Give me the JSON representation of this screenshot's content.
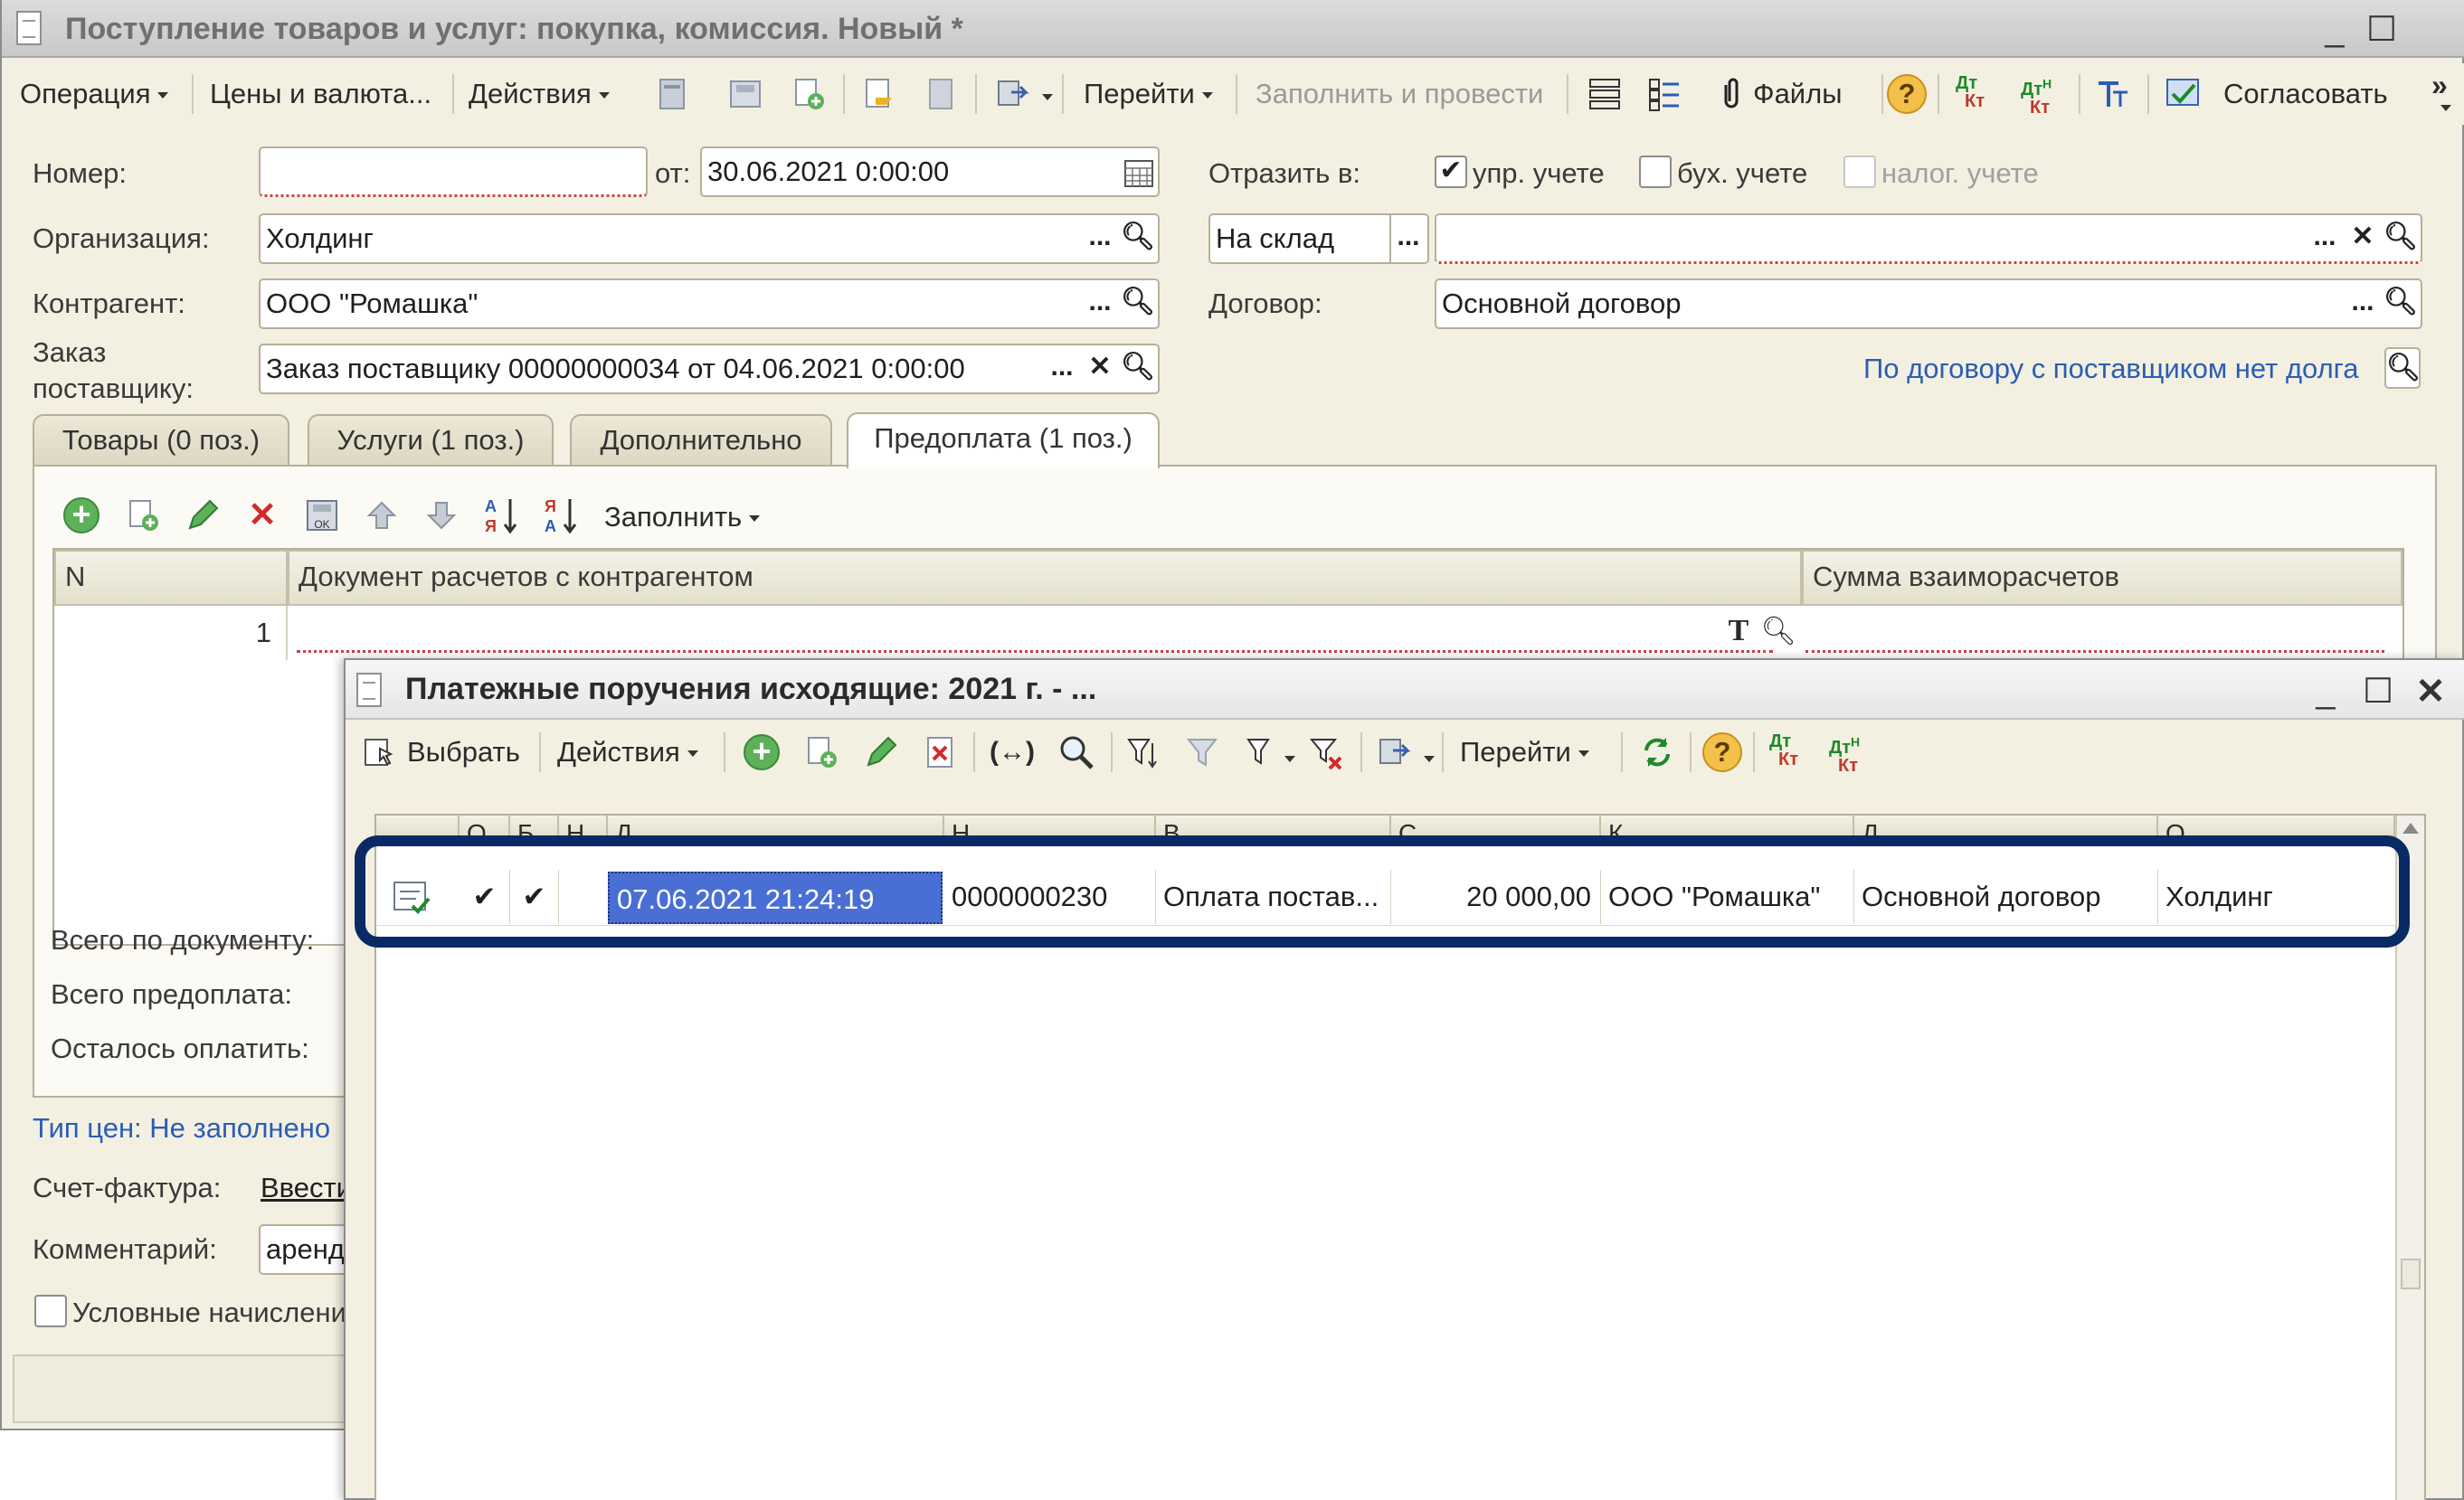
{
  "main_window": {
    "title": "Поступление товаров и услуг: покупка, комиссия. Новый *",
    "toolbar": {
      "operation": "Операция",
      "prices_currency": "Цены и валюта...",
      "actions": "Действия",
      "go_to": "Перейти",
      "fill_and_post": "Заполнить и провести",
      "files": "Файлы",
      "approve": "Согласовать",
      "more": "»"
    },
    "form": {
      "number_label": "Номер:",
      "number_value": "",
      "date_label": "от:",
      "date_value": "30.06.2021  0:00:00",
      "reflect_label": "Отразить в:",
      "mgmt_label": "упр. учете",
      "acct_label": "бух. учете",
      "tax_label": "налог. учете",
      "org_label": "Организация:",
      "org_value": "Холдинг",
      "warehouse_value": "На склад",
      "counterparty_label": "Контрагент:",
      "counterparty_value": "ООО \"Ромашка\"",
      "contract_label": "Договор:",
      "contract_value": "Основной договор",
      "order_label_1": "Заказ",
      "order_label_2": "поставщику:",
      "order_value": "Заказ поставщику 00000000034 от 04.06.2021 0:00:00",
      "debt_link": "По договору с поставщиком нет долга"
    },
    "tabs": [
      {
        "label": "Товары (0 поз.)"
      },
      {
        "label": "Услуги (1 поз.)"
      },
      {
        "label": "Дополнительно"
      },
      {
        "label": "Предоплата (1 поз.)"
      }
    ],
    "tab_toolbar": {
      "fill": "Заполнить"
    },
    "grid": {
      "columns": [
        "N",
        "Документ расчетов с контрагентом",
        "Сумма взаиморасчетов"
      ],
      "rows": [
        {
          "n": "1",
          "document": "",
          "amount": ""
        }
      ]
    },
    "totals": {
      "total_doc": "Всего по документу:",
      "total_prepay": "Всего предоплата:",
      "remaining": "Осталось оплатить:"
    },
    "price_type_link": "Тип цен: Не заполнено",
    "invoice_label": "Счет-фактура:",
    "invoice_link": "Ввести",
    "comment_label": "Комментарий:",
    "comment_value": "аренд",
    "conditional_label": "Условные начислени"
  },
  "child_window": {
    "title": "Платежные поручения исходящие: 2021 г. - ...",
    "toolbar": {
      "select": "Выбрать",
      "actions": "Действия",
      "go_to": "Перейти"
    },
    "columns": [
      "",
      "О",
      "Б",
      "Н",
      "Д",
      "Н",
      "В",
      "С",
      "К",
      "Д",
      "О"
    ],
    "rows": [
      {
        "posted": "✔",
        "accounted": "✔",
        "date": "07.06.2021 21:24:19",
        "number": "0000000230",
        "operation": "Оплата постав...",
        "amount": "20 000,00",
        "counterparty": "ООО \"Ромашка\"",
        "contract": "Основной договор",
        "organization": "Холдинг"
      }
    ]
  },
  "colors": {
    "window_bg": "#f3f0e2",
    "highlight_frame": "#0a2a66",
    "selected_cell": "#4a6fd4",
    "link": "#2a5db5"
  }
}
